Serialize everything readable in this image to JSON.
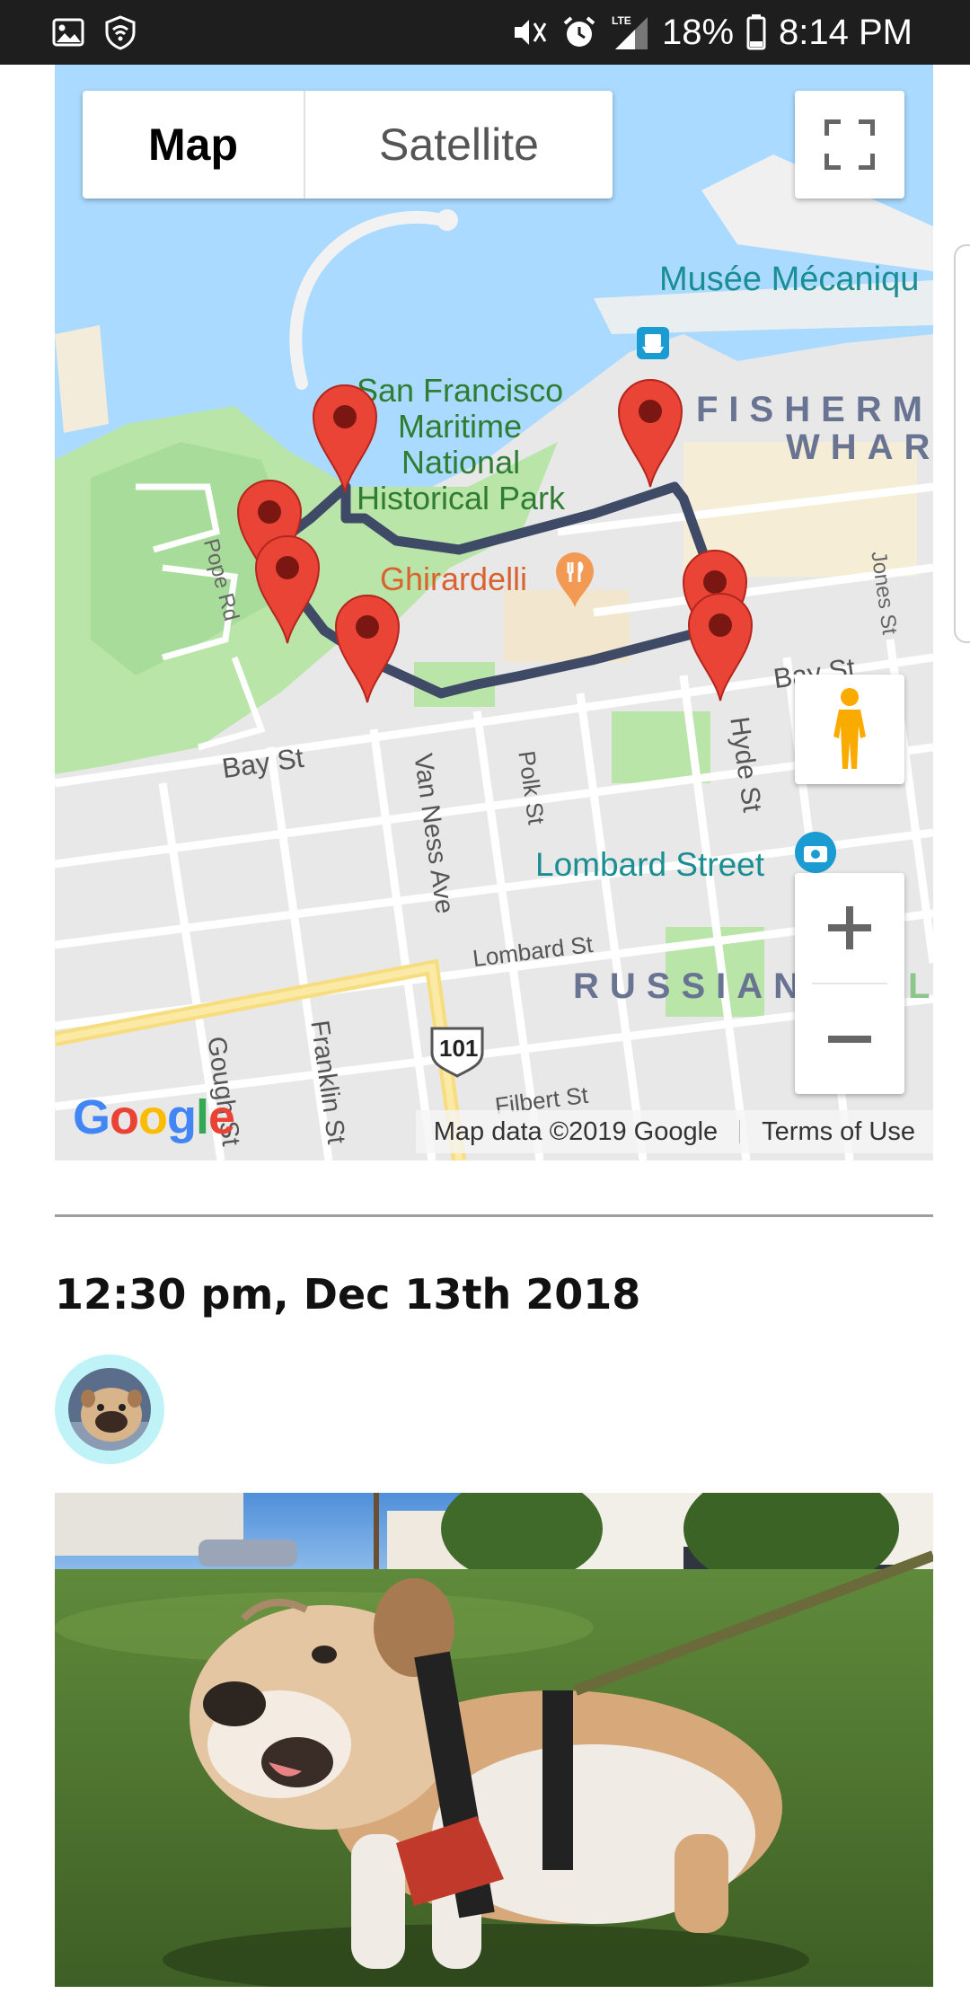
{
  "status_bar": {
    "battery": "18%",
    "time": "8:14 PM",
    "network": "LTE",
    "icons": [
      "gallery-icon",
      "shield-wifi-icon",
      "mute-icon",
      "alarm-icon",
      "signal-icon",
      "battery-icon"
    ]
  },
  "map": {
    "type_buttons": {
      "map": "Map",
      "satellite": "Satellite"
    },
    "selected_type": "Map",
    "labels": {
      "musee": "Musée Mécaniqu",
      "park_1": "San Francisco",
      "park_2": "Maritime",
      "park_3": "National",
      "park_4": "Historical Park",
      "ghirardelli": "Ghirardelli",
      "fisherman_1": "FISHERM",
      "fisherman_2": "WHAR",
      "jones": "Jones St",
      "pope": "Pope Rd",
      "bay_left": "Bay St",
      "bay_right": "Bay St",
      "van_ness": "Van Ness Ave",
      "polk": "Polk St",
      "hyde": "Hyde St",
      "lombard_street": "Lombard Street",
      "lombard_st": "Lombard St",
      "russian": "RUSSIAN",
      "russian_tail": "L",
      "gough": "Gough St",
      "franklin": "Franklin St",
      "filbert": "Filbert St",
      "hwy": "101"
    },
    "google_logo": "Google",
    "attribution": {
      "data": "Map data ©2019 Google",
      "terms": "Terms of Use"
    },
    "route_color": "#3f4b66",
    "pin_color": "#e94435"
  },
  "post": {
    "timestamp": "12:30 pm, Dec 13th 2018",
    "avatar_ring_color": "#bff3f7"
  }
}
